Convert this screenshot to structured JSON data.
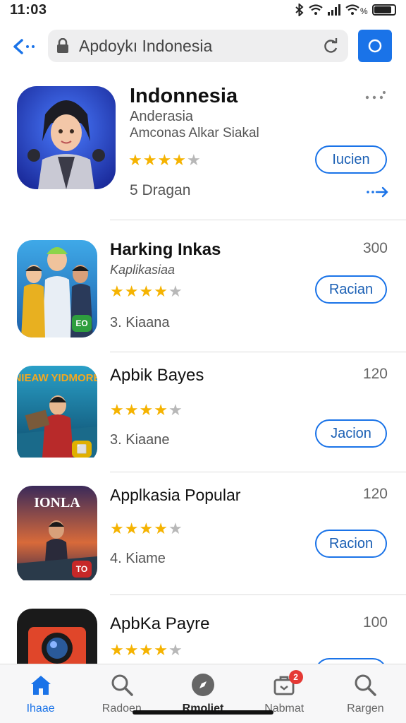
{
  "status": {
    "time": "11:03"
  },
  "header": {
    "search_text": "Apdoykı Indonesia"
  },
  "featured": {
    "title": "Indonnesia",
    "developer": "Anderasia",
    "subtitle": "Amconas Alkar Siakal",
    "rating": 3.5,
    "count": "5 Dragan",
    "button": "Iucien"
  },
  "apps": [
    {
      "name": "Harking Inkas",
      "sub": "Kaplikasiaa",
      "size": "300",
      "rating": 4,
      "count": "3. Kiaana",
      "button": "Racian",
      "badge": "EO",
      "badge_color": "#2e9e3e"
    },
    {
      "name": "Apbik Bayes",
      "sub": "",
      "size": "120",
      "rating": 4,
      "count": "3. Kiaane",
      "button": "Jacion",
      "badge": "⬜",
      "badge_color": "#e0b000"
    },
    {
      "name": "Applkasia Popular",
      "sub": "",
      "size": "120",
      "rating": 4,
      "count": "4. Kiame",
      "button": "Racion",
      "badge": "TO",
      "badge_color": "#c62828"
    },
    {
      "name": "ApbKa Payre",
      "sub": "",
      "size": "100",
      "rating": 4,
      "count": "",
      "button": "",
      "badge": "",
      "badge_color": ""
    }
  ],
  "icon_texts": {
    "app3_banner": "NIEAW YIDMORE",
    "app4_banner": "IONLA"
  },
  "tabs": [
    {
      "label": "Ihaae",
      "icon": "home-icon"
    },
    {
      "label": "Radoen",
      "icon": "search-icon"
    },
    {
      "label": "Rmoliet",
      "icon": "compass-icon"
    },
    {
      "label": "Nabmat",
      "icon": "updates-icon",
      "badge": "2"
    },
    {
      "label": "Rargen",
      "icon": "search-icon"
    }
  ],
  "colors": {
    "accent": "#1a73e8",
    "star": "#f5b301",
    "badge": "#e53935"
  }
}
